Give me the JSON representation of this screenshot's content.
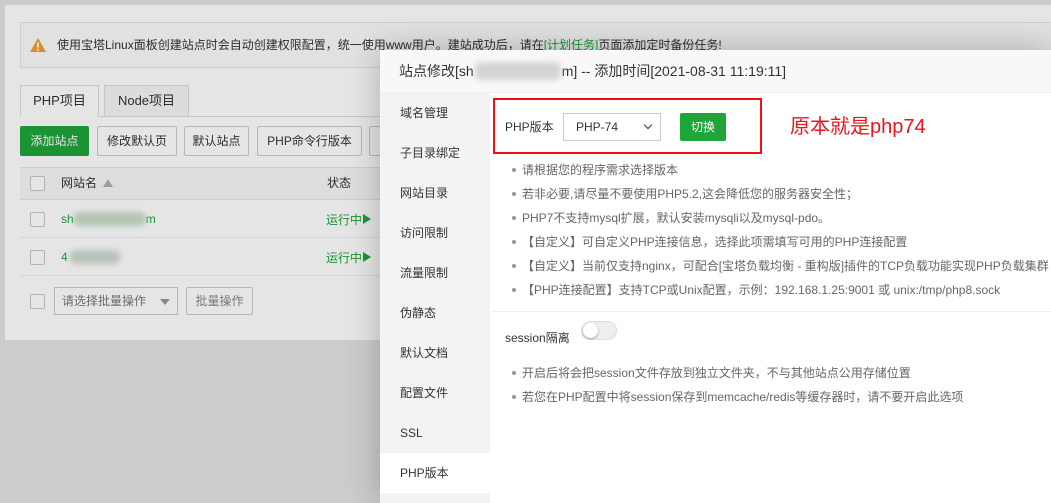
{
  "notice": {
    "icon": "warning-icon",
    "text_before": "使用宝塔Linux面板创建站点时会自动创建权限配置，统一使用www用户。建站成功后，请在",
    "link": "[计划任务]",
    "text_after": "页面添加定时备份任务!"
  },
  "tabs": [
    {
      "label": "PHP项目",
      "active": true
    },
    {
      "label": "Node项目",
      "active": false
    }
  ],
  "toolbar": {
    "add_site": "添加站点",
    "edit_default_page": "修改默认页",
    "default_site": "默认站点",
    "php_cli_version": "PHP命令行版本"
  },
  "table": {
    "columns": {
      "name": "网站名",
      "name_sort_icon": "sort-asc-icon",
      "status": "状态"
    },
    "rows": [
      {
        "name_start": "sh",
        "name_end": "m",
        "status": "运行中",
        "status_icon": "play-icon"
      },
      {
        "name_start": "4",
        "status": "运行中",
        "status_icon": "play-icon"
      }
    ]
  },
  "batch": {
    "select_placeholder": "请选择批量操作",
    "apply_button": "批量操作"
  },
  "modal": {
    "title_prefix": "站点修改[sh",
    "title_suffix": "m] -- 添加时间[2021-08-31 11:19:11]",
    "menu": [
      {
        "label": "域名管理"
      },
      {
        "label": "子目录绑定"
      },
      {
        "label": "网站目录"
      },
      {
        "label": "访问限制"
      },
      {
        "label": "流量限制"
      },
      {
        "label": "伪静态"
      },
      {
        "label": "默认文档"
      },
      {
        "label": "配置文件"
      },
      {
        "label": "SSL"
      },
      {
        "label": "PHP版本",
        "active": true
      }
    ],
    "php_version": {
      "label": "PHP版本",
      "selected": "PHP-74",
      "switch_button": "切换"
    },
    "tips": [
      "请根据您的程序需求选择版本",
      "若非必要,请尽量不要使用PHP5.2,这会降低您的服务器安全性；",
      "PHP7不支持mysql扩展，默认安装mysqli以及mysql-pdo。",
      "【自定义】可自定义PHP连接信息，选择此项需填写可用的PHP连接配置",
      "【自定义】当前仅支持nginx，可配合[宝塔负载均衡 - 重构版]插件的TCP负载功能实现PHP负载集群",
      "【PHP连接配置】支持TCP或Unix配置，示例：192.168.1.25:9001 或 unix:/tmp/php8.sock"
    ],
    "session": {
      "label": "session隔离",
      "enabled": false,
      "tips": [
        "开启后将会把session文件存放到独立文件夹，不与其他站点公用存储位置",
        "若您在PHP配置中将session保存到memcache/redis等缓存器时，请不要开启此选项"
      ]
    }
  },
  "annotation": {
    "text": "原本就是php74"
  },
  "colors": {
    "brand_green": "#20a53a",
    "annotation_red": "#e8161b",
    "highlight_border": "#ee1111"
  }
}
